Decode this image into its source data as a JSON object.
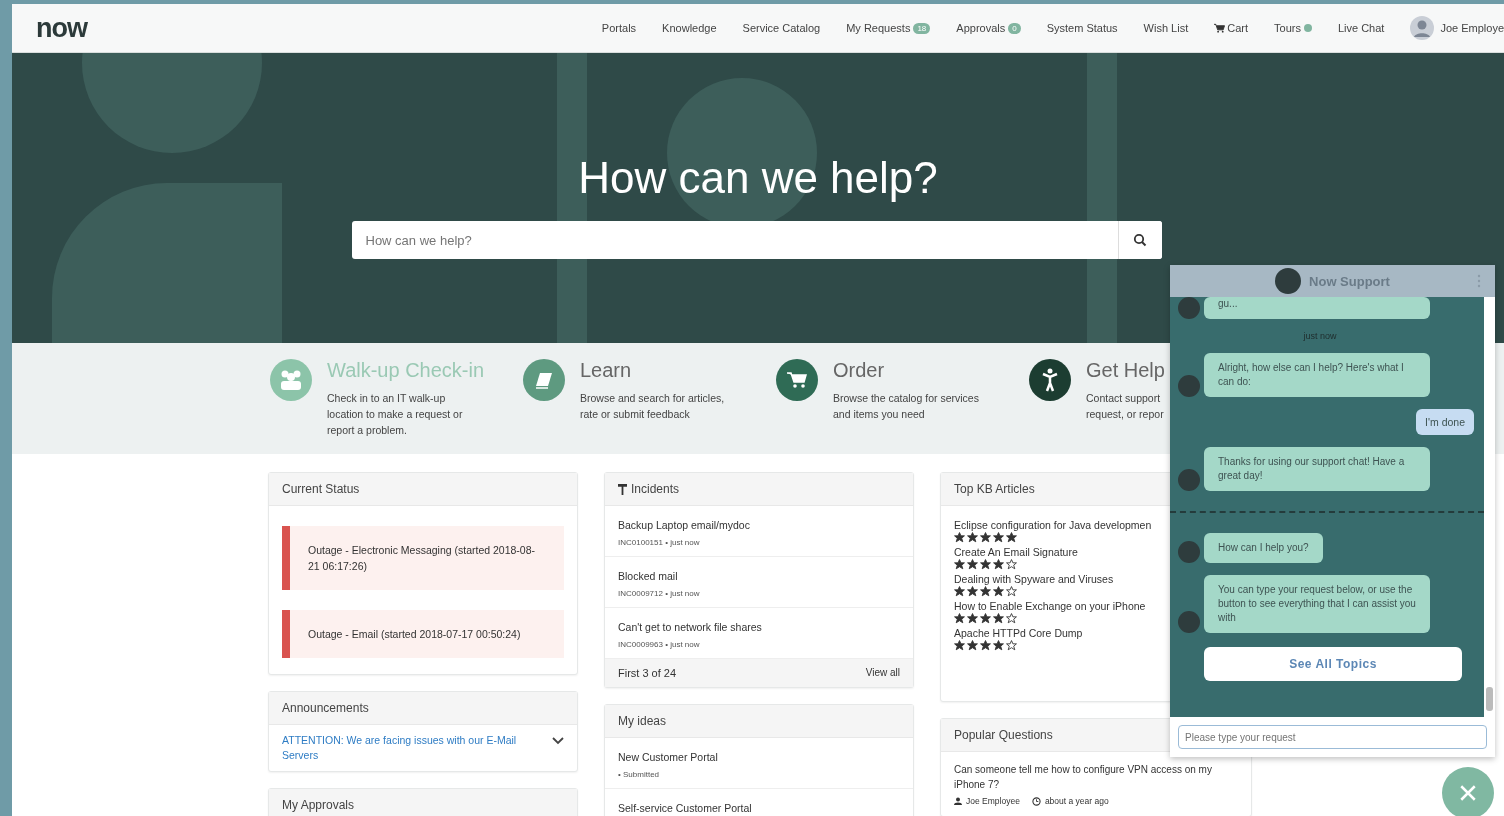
{
  "header": {
    "logo": "now",
    "nav": [
      {
        "kind": "link",
        "label": "Portals"
      },
      {
        "kind": "link",
        "label": "Knowledge"
      },
      {
        "kind": "link",
        "label": "Service Catalog"
      },
      {
        "kind": "badge",
        "label": "My Requests",
        "badge": "18"
      },
      {
        "kind": "badge",
        "label": "Approvals",
        "badge": "0"
      },
      {
        "kind": "link",
        "label": "System Status"
      },
      {
        "kind": "link",
        "label": "Wish List"
      },
      {
        "kind": "cart",
        "label": "Cart"
      },
      {
        "kind": "dot",
        "label": "Tours"
      },
      {
        "kind": "link",
        "label": "Live Chat"
      }
    ],
    "user": {
      "name": "Joe Employe"
    }
  },
  "hero": {
    "title": "How can we help?",
    "search": {
      "placeholder": "How can we help?"
    }
  },
  "features": [
    {
      "kind": "people",
      "title": "Walk-up Check-in",
      "color": "#8cc4a9",
      "lines": [
        "Check in to an IT walk-up",
        "location to make a request or",
        "report a problem."
      ]
    },
    {
      "kind": "book",
      "title": "Learn",
      "color": "#5e9a80",
      "lines": [
        "Browse and search for articles,",
        "rate or submit feedback"
      ]
    },
    {
      "kind": "cart",
      "title": "Order",
      "color": "#2f6b55",
      "lines": [
        "Browse the catalog for services",
        "and items you need"
      ]
    },
    {
      "kind": "person",
      "title": "Get Help",
      "color": "#1c3d31",
      "lines": [
        "Contact support",
        "request, or repor"
      ]
    }
  ],
  "current_status": {
    "title": "Current Status",
    "items": [
      "Outage - Electronic Messaging (started 2018-08-21 06:17:26)",
      "Outage - Email (started 2018-07-17 00:50:24)"
    ]
  },
  "announcements": {
    "title": "Announcements",
    "items": [
      {
        "text": "ATTENTION: We are facing issues with our E-Mail Servers",
        "expanded": false
      }
    ]
  },
  "my_approvals": {
    "title": "My Approvals"
  },
  "incidents": {
    "title": "Incidents",
    "items": [
      {
        "title": "Backup Laptop email/mydoc",
        "meta": "INC0100151 • just now"
      },
      {
        "title": "Blocked mail",
        "meta": "INC0009712 • just now"
      },
      {
        "title": "Can't get to network file shares",
        "meta": "INC0009963 • just now"
      }
    ],
    "footer": "First 3 of 24",
    "view_all": "View all"
  },
  "my_ideas": {
    "title": "My ideas",
    "items": [
      {
        "title": "New Customer Portal",
        "meta": "• Submitted"
      },
      {
        "title": "Self-service Customer Portal"
      }
    ]
  },
  "top_kb": {
    "title": "Top KB Articles",
    "items": [
      {
        "title": "Eclipse configuration for Java developmen",
        "stars": 5
      },
      {
        "title": "Create An Email Signature",
        "stars": 4
      },
      {
        "title": "Dealing with Spyware and Viruses",
        "stars": 4
      },
      {
        "title": "How to Enable Exchange on your iPhone",
        "stars": 4
      },
      {
        "title": "Apache HTTPd Core Dump",
        "stars": 4
      }
    ]
  },
  "popular_questions": {
    "title": "Popular Questions",
    "items": [
      {
        "question": "Can someone tell me how to configure VPN access on my iPhone 7?",
        "author": "Joe Employee",
        "time": "about a year ago"
      }
    ]
  },
  "chat": {
    "title": "Now Support",
    "messages": [
      {
        "kind": "bot",
        "text": "gu..."
      },
      {
        "kind": "time",
        "text": "just now"
      },
      {
        "kind": "bot",
        "text": "Alright, how else can I help? Here's what I can do:"
      },
      {
        "kind": "user",
        "text": "I'm done"
      },
      {
        "kind": "bot",
        "text": "Thanks for using our support chat! Have a great day!"
      },
      {
        "kind": "divider"
      },
      {
        "kind": "bot",
        "text": "How can I help you?"
      },
      {
        "kind": "bot",
        "text": "You can type your request below, or use the button to see everything that I can assist you with"
      }
    ],
    "button": "See All Topics",
    "input": {
      "placeholder": "Please type your request"
    }
  }
}
